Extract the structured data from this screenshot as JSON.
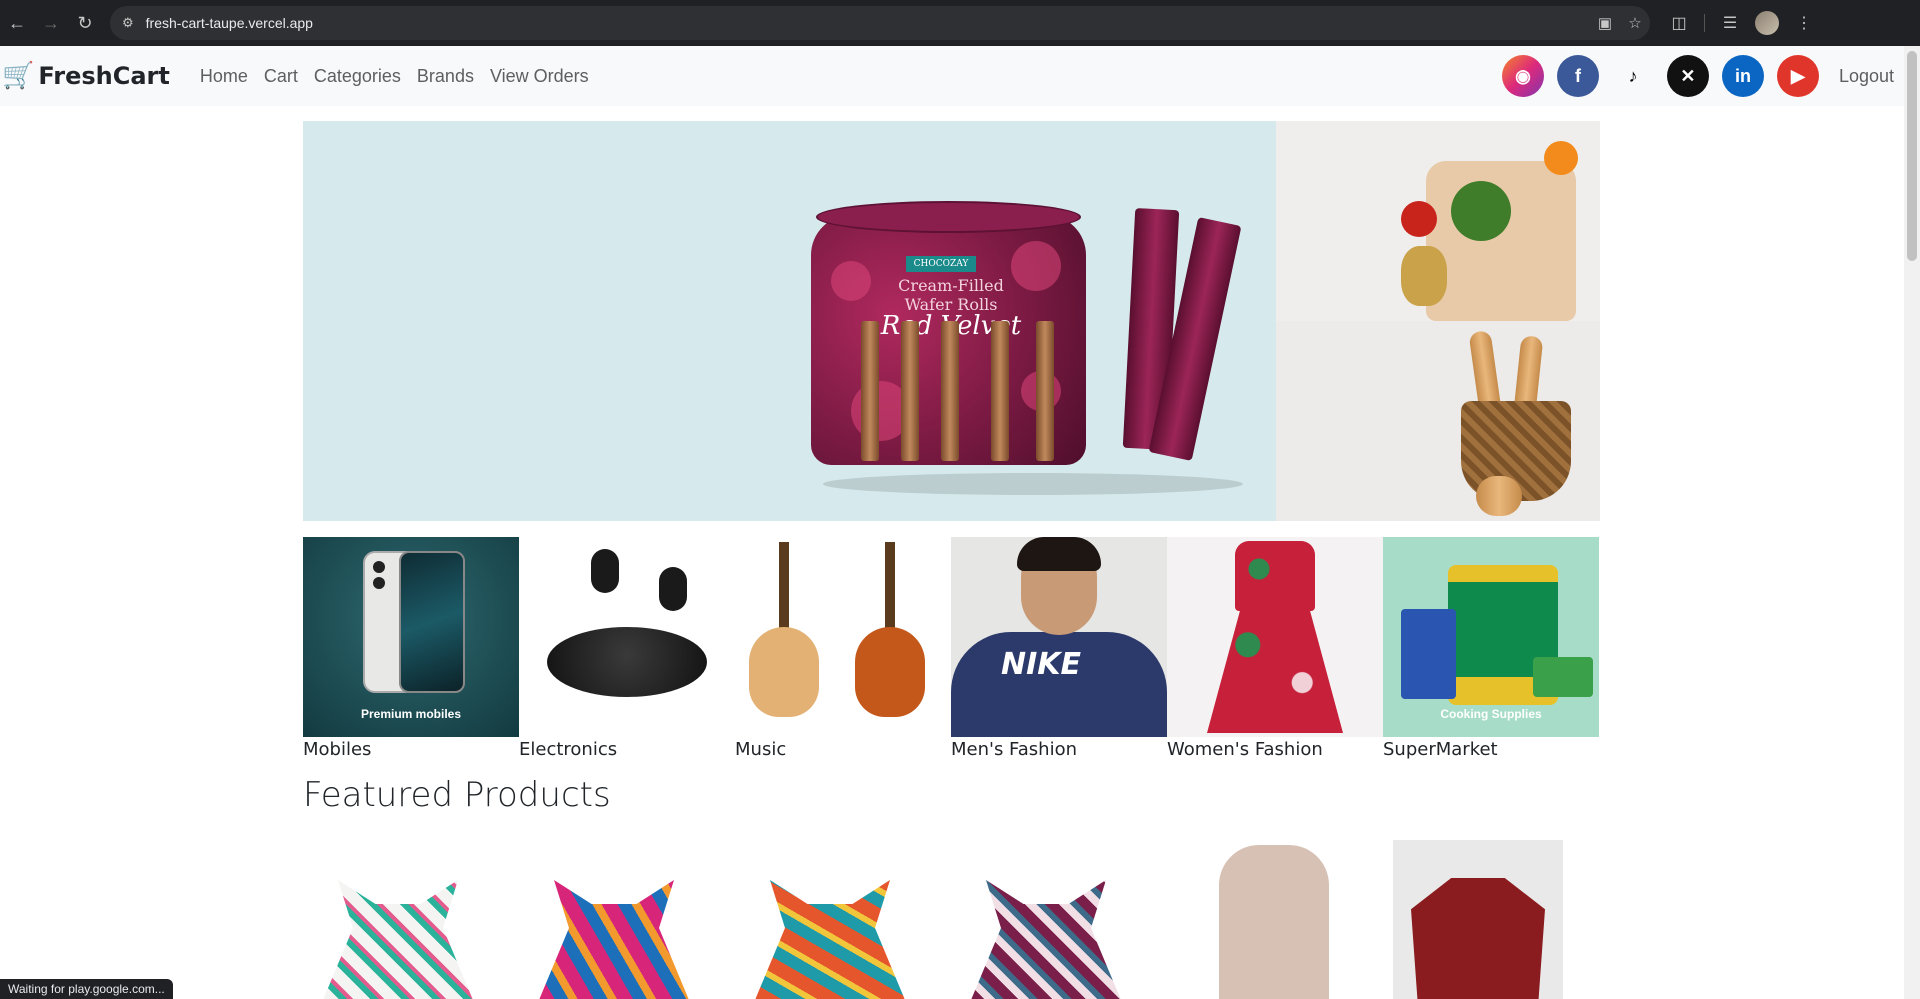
{
  "browser": {
    "url": "fresh-cart-taupe.vercel.app",
    "status_text": "Waiting for play.google.com..."
  },
  "navbar": {
    "brand": "FreshCart",
    "links": [
      "Home",
      "Cart",
      "Categories",
      "Brands",
      "View Orders"
    ],
    "socials": [
      "instagram-icon",
      "facebook-icon",
      "tiktok-icon",
      "x-icon",
      "linkedin-icon",
      "youtube-icon"
    ],
    "logout": "Logout"
  },
  "hero": {
    "main_product": {
      "brand": "CHOCOZAY",
      "subtitle": "Cream-Filled Wafer Rolls",
      "flavor": "Red Velvet"
    }
  },
  "categories": [
    {
      "name": "Mobiles",
      "overlay": "Premium mobiles"
    },
    {
      "name": "Electronics",
      "overlay": ""
    },
    {
      "name": "Music",
      "overlay": ""
    },
    {
      "name": "Men's Fashion",
      "overlay": ""
    },
    {
      "name": "Women's Fashion",
      "overlay": ""
    },
    {
      "name": "SuperMarket",
      "overlay": "Cooking Supplies"
    }
  ],
  "featured": {
    "title": "Featured Products"
  },
  "colors": {
    "brand_green": "#0aad0a",
    "navbar_bg": "#f8f9fa",
    "hero_bg": "#d6eaed"
  }
}
